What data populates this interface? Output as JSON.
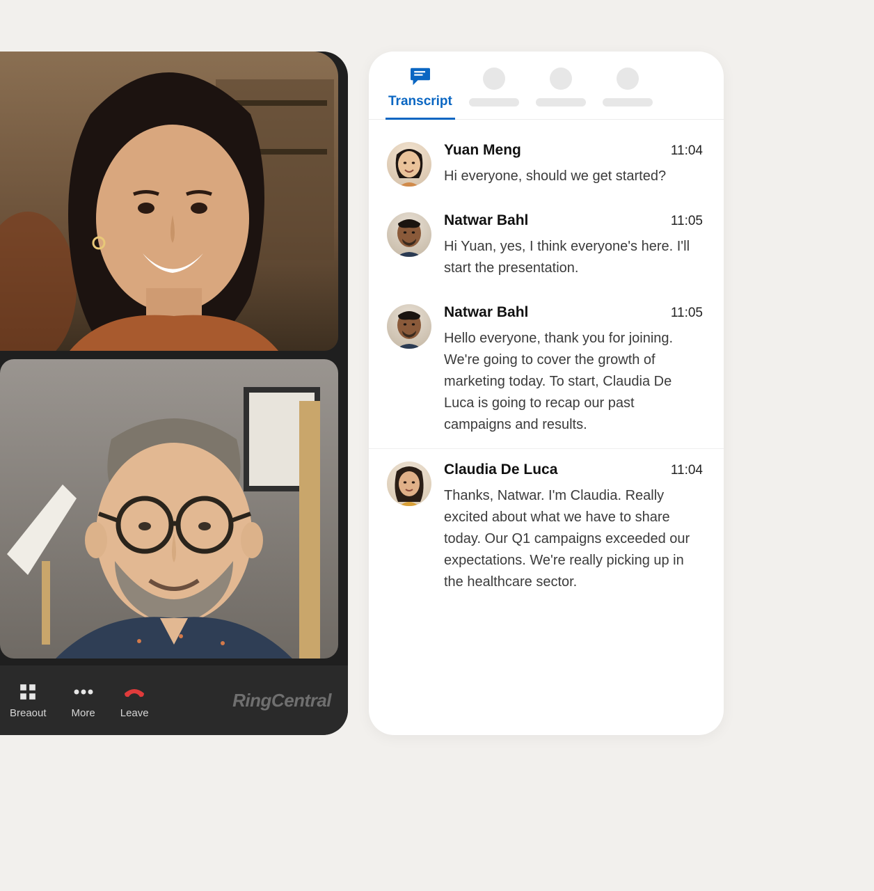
{
  "video": {
    "toolbar": {
      "breakout_label": "Breaout",
      "more_label": "More",
      "leave_label": "Leave"
    },
    "brand": "RingCentral"
  },
  "transcript": {
    "tab_label": "Transcript",
    "entries": [
      {
        "speaker": "Yuan Meng",
        "time": "11:04",
        "text": "Hi everyone, should we get started?",
        "avatar": "yuan"
      },
      {
        "speaker": "Natwar Bahl",
        "time": "11:05",
        "text": "Hi Yuan, yes, I think everyone's here. I'll start the presentation.",
        "avatar": "natwar"
      },
      {
        "speaker": "Natwar Bahl",
        "time": "11:05",
        "text": "Hello everyone, thank you for joining. We're going to cover the growth of marketing today. To start, Claudia De Luca is going to recap our past campaigns and results.",
        "avatar": "natwar"
      },
      {
        "speaker": "Claudia De Luca",
        "time": "11:04",
        "text": "Thanks, Natwar. I'm Claudia. Really excited about what we have to share today. Our Q1 campaigns exceeded our expectations. We're really picking up in the healthcare sector.",
        "avatar": "claudia"
      }
    ]
  }
}
